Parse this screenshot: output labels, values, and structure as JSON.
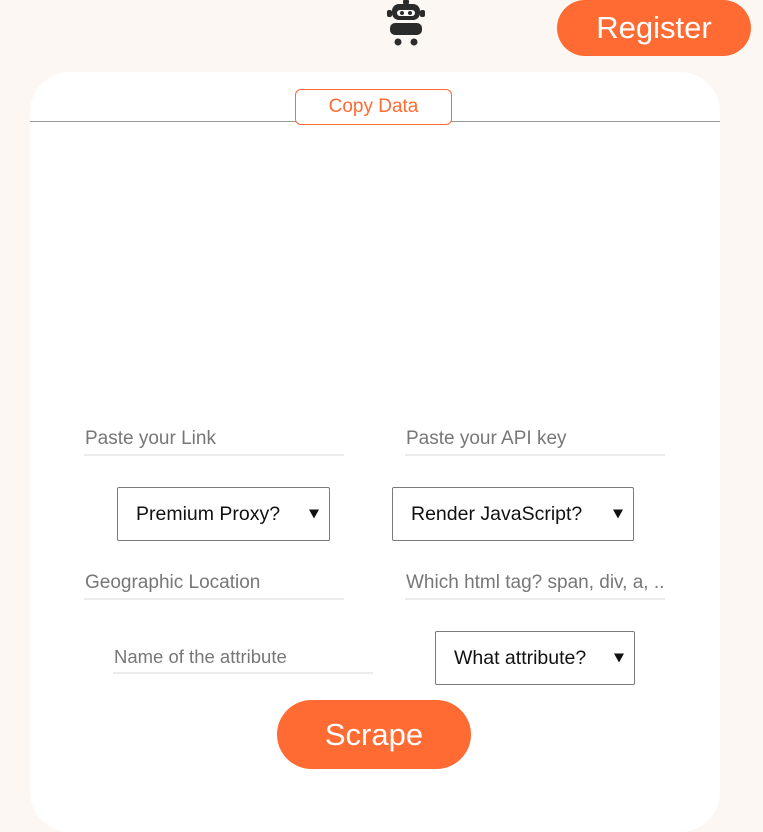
{
  "header": {
    "logo_icon": "robot-icon",
    "register_label": "Register"
  },
  "toolbar": {
    "copy_label": "Copy Data"
  },
  "form": {
    "link_placeholder": "Paste your Link",
    "api_key_placeholder": "Paste your API key",
    "premium_proxy_label": "Premium Proxy?",
    "render_js_label": "Render JavaScript?",
    "location_placeholder": "Geographic Location",
    "html_tag_placeholder": "Which html tag? span, div, a, ...",
    "attribute_name_placeholder": "Name of the attribute",
    "what_attribute_label": "What attribute?",
    "scrape_label": "Scrape"
  },
  "colors": {
    "accent": "#ff6b33",
    "background": "#fcf7f2",
    "card": "#ffffff"
  }
}
